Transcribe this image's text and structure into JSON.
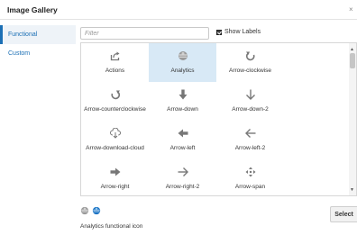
{
  "dialog": {
    "title": "Image Gallery",
    "close_glyph": "×"
  },
  "sidebar": {
    "items": [
      {
        "label": "Functional",
        "active": true
      },
      {
        "label": "Custom",
        "active": false
      }
    ]
  },
  "filter": {
    "value": "",
    "placeholder": "Filter"
  },
  "show_labels": {
    "label": "Show Labels",
    "checked": true
  },
  "icons": [
    {
      "label": "Actions",
      "icon": "share-arrow-icon"
    },
    {
      "label": "Analytics",
      "icon": "analytics-ball-icon",
      "selected": true
    },
    {
      "label": "Arrow-clockwise",
      "icon": "arrow-clockwise-icon"
    },
    {
      "label": "Arrow-counterclockwise",
      "icon": "arrow-counterclockwise-icon"
    },
    {
      "label": "Arrow-down",
      "icon": "arrow-down-icon"
    },
    {
      "label": "Arrow-down-2",
      "icon": "arrow-down-2-icon"
    },
    {
      "label": "Arrow-download-cloud",
      "icon": "arrow-download-cloud-icon"
    },
    {
      "label": "Arrow-left",
      "icon": "arrow-left-icon"
    },
    {
      "label": "Arrow-left-2",
      "icon": "arrow-left-2-icon"
    },
    {
      "label": "Arrow-right",
      "icon": "arrow-right-icon"
    },
    {
      "label": "Arrow-right-2",
      "icon": "arrow-right-2-icon"
    },
    {
      "label": "Arrow-span",
      "icon": "arrow-span-icon"
    }
  ],
  "preview": {
    "icons": [
      "analytics-gray-icon",
      "analytics-blue-icon"
    ],
    "caption": "Analytics functional icon"
  },
  "actions": {
    "select_label": "Select"
  },
  "colors": {
    "accent": "#1b6fb5",
    "selected_bg": "#d8e9f6",
    "icon_gray": "#777777"
  }
}
